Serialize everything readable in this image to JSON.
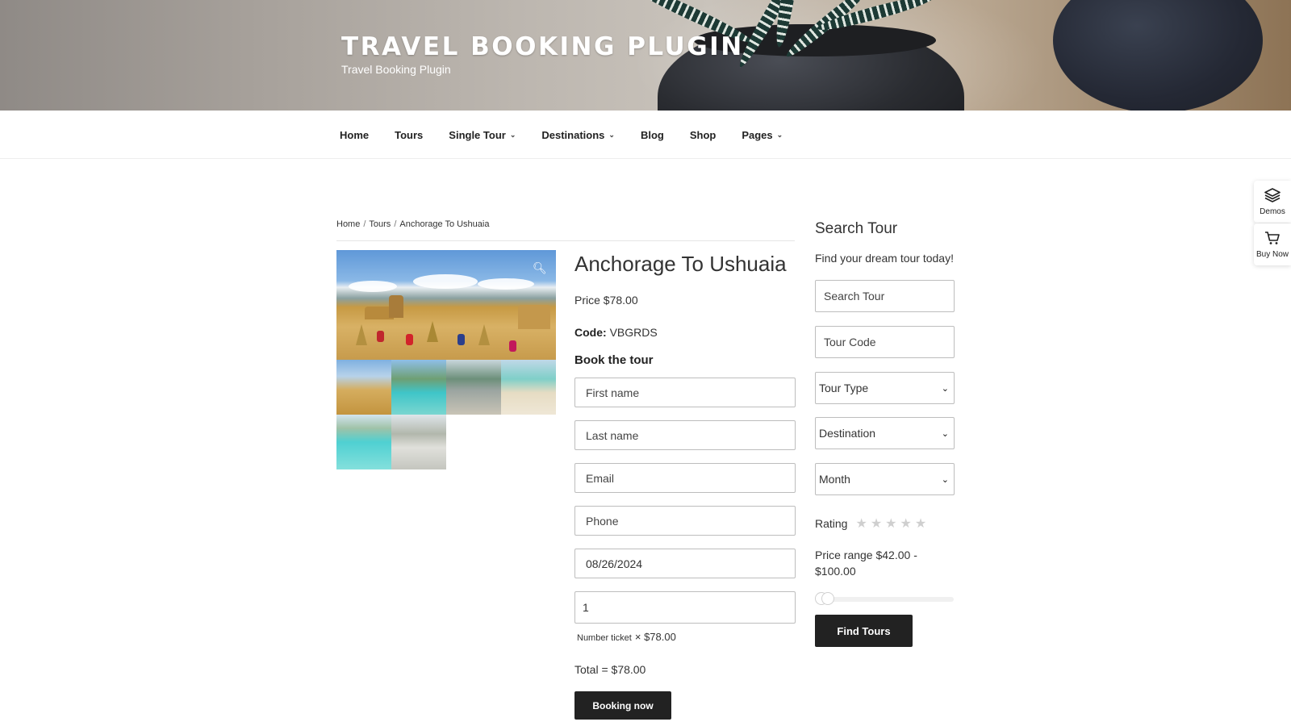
{
  "site": {
    "title": "TRAVEL BOOKING PLUGIN",
    "tagline": "Travel Booking Plugin"
  },
  "nav": {
    "items": [
      {
        "label": "Home",
        "has_dropdown": false
      },
      {
        "label": "Tours",
        "has_dropdown": false
      },
      {
        "label": "Single Tour",
        "has_dropdown": true
      },
      {
        "label": "Destinations",
        "has_dropdown": true
      },
      {
        "label": "Blog",
        "has_dropdown": false
      },
      {
        "label": "Shop",
        "has_dropdown": false
      },
      {
        "label": "Pages",
        "has_dropdown": true
      }
    ]
  },
  "side_buttons": {
    "demos": {
      "label": "Demos",
      "icon": "layers-icon"
    },
    "buy": {
      "label": "Buy Now",
      "icon": "cart-icon"
    }
  },
  "breadcrumb": {
    "items": [
      "Home",
      "Tours",
      "Anchorage To Ushuaia"
    ],
    "separator": "/"
  },
  "tour": {
    "title": "Anchorage To Ushuaia",
    "price": "Price $78.00",
    "code_label": "Code:",
    "code_value": "VBGRDS",
    "book_heading": "Book the tour"
  },
  "booking_form": {
    "first_name_placeholder": "First name",
    "last_name_placeholder": "Last name",
    "email_placeholder": "Email",
    "phone_placeholder": "Phone",
    "date_value": "08/26/2024",
    "tickets_value": "1",
    "ticket_label": "Number ticket",
    "ticket_price": "× $78.00",
    "total": "Total = $78.00",
    "submit_label": "Booking now"
  },
  "search": {
    "heading": "Search Tour",
    "subtitle": "Find your dream tour today!",
    "search_placeholder": "Search Tour",
    "code_placeholder": "Tour Code",
    "tour_type": "Tour Type",
    "destination": "Destination",
    "month": "Month",
    "rating_label": "Rating",
    "rating_stars": 5,
    "price_range": "Price range $42.00 - $100.00",
    "submit_label": "Find Tours"
  },
  "colors": {
    "button_bg": "#222222",
    "field_border": "#bdbdbd",
    "star_empty": "#cfcfcf"
  }
}
